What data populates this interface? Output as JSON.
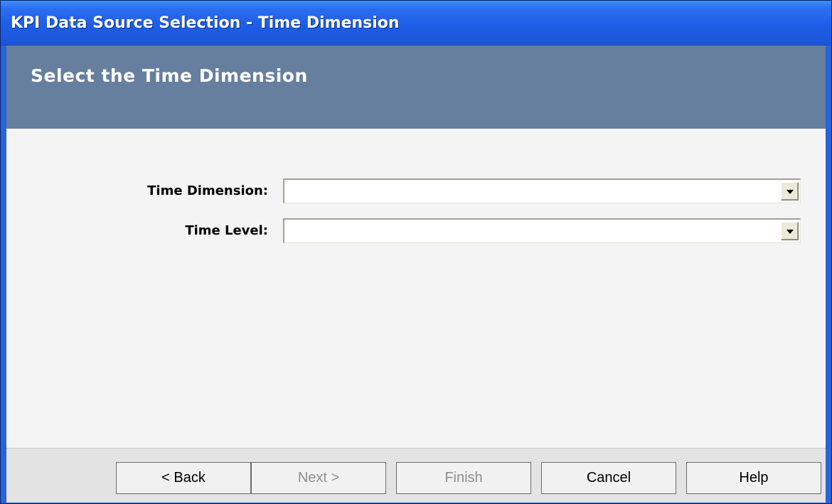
{
  "window": {
    "title": "KPI Data Source Selection - Time Dimension"
  },
  "header": {
    "title": "Select the Time Dimension"
  },
  "form": {
    "time_dimension_label": "Time Dimension:",
    "time_dimension_value": "",
    "time_level_label": "Time Level:",
    "time_level_value": ""
  },
  "footer": {
    "back_label": "< Back",
    "next_label": "Next >",
    "finish_label": "Finish",
    "cancel_label": "Cancel",
    "help_label": "Help"
  },
  "icons": {
    "dropdown": "chevron-down-icon"
  },
  "colors": {
    "titlebar": "#2a6ff0",
    "header_band": "#667f9f",
    "client_bg": "#f4f4f4",
    "footer_bg": "#e3e3e3"
  }
}
